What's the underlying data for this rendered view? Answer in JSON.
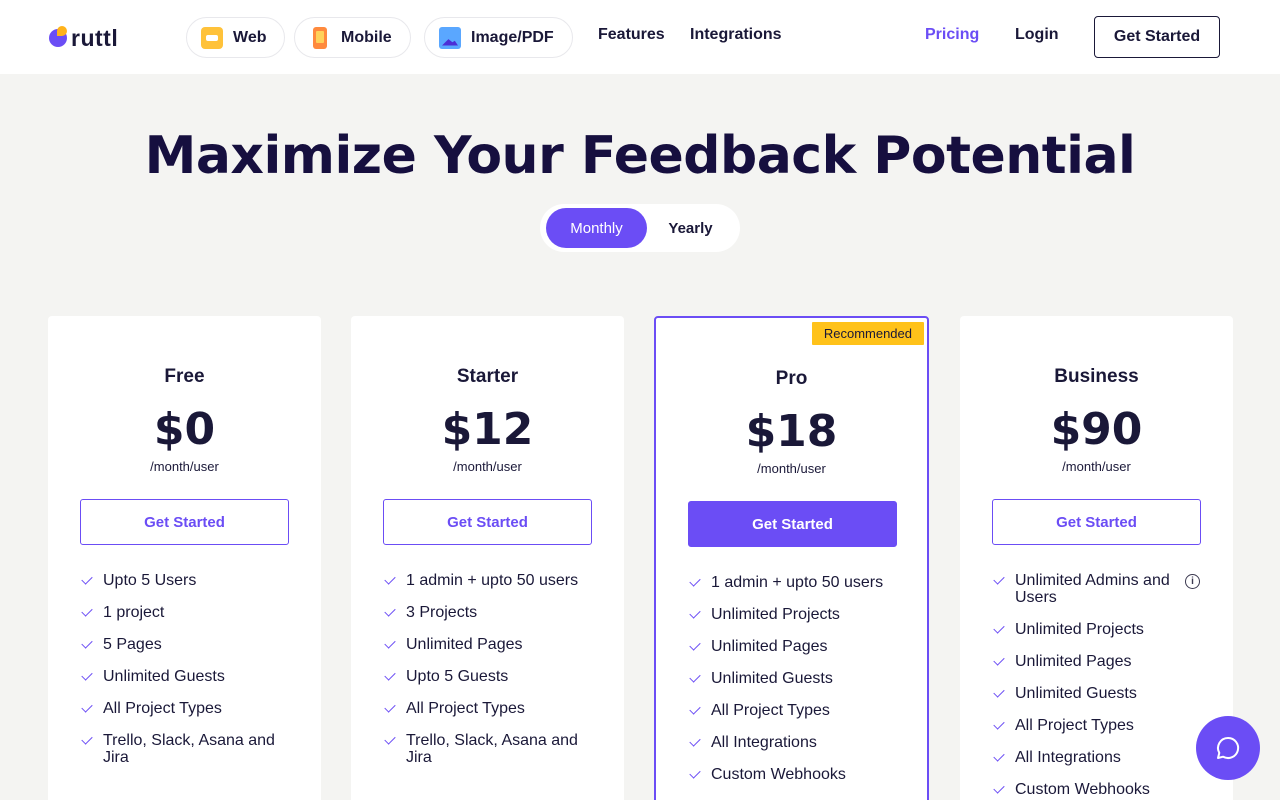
{
  "header": {
    "logo": "ruttl",
    "products": [
      {
        "label": "Web",
        "icon": "web-icon"
      },
      {
        "label": "Mobile",
        "icon": "mobile-icon"
      },
      {
        "label": "Image/PDF",
        "icon": "image-icon"
      }
    ],
    "nav": {
      "features": "Features",
      "integrations": "Integrations",
      "pricing": "Pricing",
      "login": "Login",
      "cta": "Get Started"
    }
  },
  "hero": {
    "title": "Maximize Your Feedback Potential",
    "toggle": {
      "monthly": "Monthly",
      "yearly": "Yearly",
      "selected": "Monthly"
    }
  },
  "plans": [
    {
      "name": "Free",
      "price": "$0",
      "period": "/month/user",
      "cta": "Get Started",
      "badge": "",
      "features": [
        "Upto 5 Users",
        "1 project",
        "5 Pages",
        "Unlimited Guests",
        "All Project Types",
        "Trello, Slack, Asana and Jira"
      ]
    },
    {
      "name": "Starter",
      "price": "$12",
      "period": "/month/user",
      "cta": "Get Started",
      "badge": "",
      "features": [
        "1 admin + upto 50 users",
        "3 Projects",
        "Unlimited Pages",
        "Upto 5 Guests",
        "All Project Types",
        "Trello, Slack, Asana and Jira"
      ]
    },
    {
      "name": "Pro",
      "price": "$18",
      "period": "/month/user",
      "cta": "Get Started",
      "badge": "Recommended",
      "features": [
        "1 admin + upto 50 users",
        "Unlimited Projects",
        "Unlimited Pages",
        "Unlimited Guests",
        "All Project Types",
        "All Integrations",
        "Custom Webhooks"
      ]
    },
    {
      "name": "Business",
      "price": "$90",
      "period": "/month/user",
      "cta": "Get Started",
      "badge": "",
      "features": [
        "Unlimited Admins and Users",
        "Unlimited Projects",
        "Unlimited Pages",
        "Unlimited Guests",
        "All Project Types",
        "All Integrations",
        "Custom Webhooks"
      ]
    }
  ],
  "colors": {
    "accent": "#6b4df5",
    "badge": "#ffc21a",
    "title": "#160f3f"
  }
}
